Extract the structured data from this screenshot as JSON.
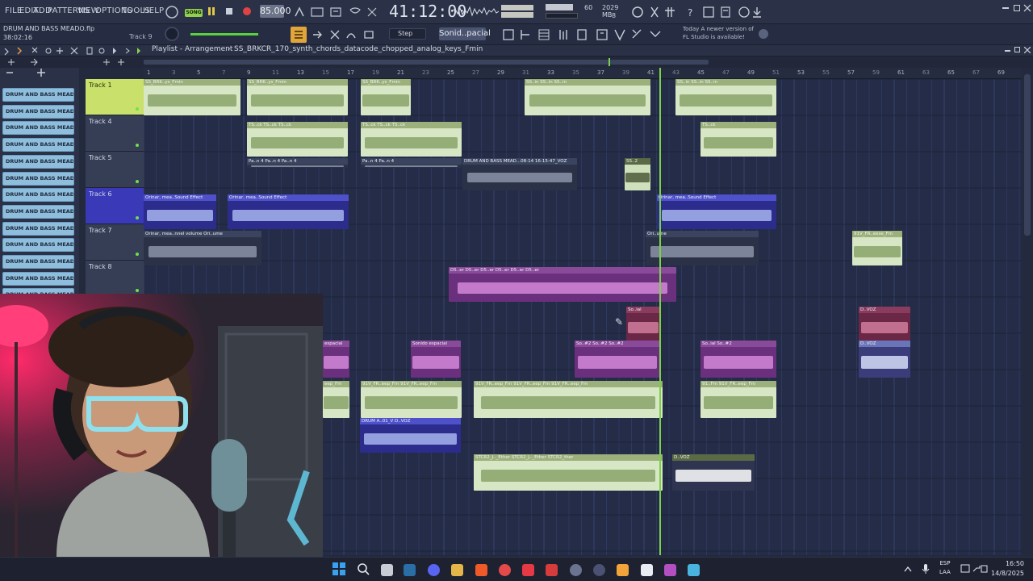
{
  "menu": [
    "FILE",
    "EDIT",
    "ADD",
    "PATTERNS",
    "VIEW",
    "OPTIONS",
    "TOOLS",
    "HELP"
  ],
  "transport": {
    "song_label": "SONG",
    "tempo": "85.000",
    "time": "41:12:00",
    "cpu_ram": "2029 MB",
    "cpu_num": "60",
    "cpu_small": "8"
  },
  "project": {
    "name": "DRUM AND BASS MEADO.flp",
    "time": "38:02:16",
    "focused_track": "Track 9"
  },
  "toolbar": {
    "snap_label": "Step",
    "pattern_selector": "Sonid..pacial"
  },
  "update_notice": {
    "line1": "Today  A newer version of",
    "line2": "FL Studio is available!"
  },
  "playlist": {
    "title": "Playlist - Arrangement",
    "path": "SS_BRKCR_170_synth_chords_datacode_chopped_analog_keys_Fmin"
  },
  "ruler": [
    "1",
    "5",
    "9",
    "13",
    "17",
    "21",
    "25",
    "29",
    "33",
    "37",
    "41",
    "45",
    "49",
    "53",
    "57",
    "61",
    "65",
    "69"
  ],
  "ruler_sub": [
    "3",
    "7",
    "11",
    "15",
    "19",
    "23",
    "27",
    "31",
    "35",
    "39",
    "43",
    "47",
    "51",
    "55",
    "59",
    "63",
    "67"
  ],
  "patterns": [
    "DRUM AND BASS MEADO...",
    "DRUM AND BASS MEADO...",
    "DRUM AND BASS MEADO...",
    "DRUM AND BASS MEADO...",
    "DRUM AND BASS MEADO...",
    "DRUM AND BASS MEADO...",
    "DRUM AND BASS MEADO...",
    "DRUM AND BASS MEADO...",
    "DRUM AND BASS MEADO...",
    "DRUM AND BASS MEADO...",
    "DRUM AND BASS MEADO...",
    "DRUM AND BASS MEADO...",
    "DRUM AND BASS MEADO..."
  ],
  "tracks": [
    "Track 1",
    "Track 4",
    "Track 5",
    "Track 6",
    "Track 7",
    "Track 8"
  ],
  "clips": {
    "c1": "SS_BRK..ys_Fmin",
    "c2": "SS_BRK..ys_Fmin",
    "c3": "SS_BRK..ys_Fmin",
    "c4": "SS..in  SS..in  SS..in",
    "c5": "SS..in  SS..in  SS..in",
    "c6": "TS..ck  TS..ck  TS..ck",
    "c7": "TS..ck  TS..ck  TS..ck",
    "c8": "TS..ck",
    "c9": "Pa..n 4  Pa..n 4  Pa..n 4",
    "c10": "Pa..n 4  Pa..n 4",
    "c11": "DRUM AND BASS MEAD...08-14 16-15-47_VOZ",
    "c12": "SS..2",
    "c13": "Orinar, mea..Sound Effect",
    "c14": "Orinar, mea..Sound Effect",
    "c15": "Orinar, mea..Sound Effect",
    "c16": "Orinar, mea..nnel volume  Ori..ume",
    "c17": "Ori..ume",
    "c18": "91V_FR..eese_Fm",
    "c19": "D5..er  D5..er  D5..er  D5..er  D5..er  D5..er",
    "c20": "So..ial",
    "c21": "D..VOZ",
    "c22": "espacial",
    "c23": "Sonido espacial",
    "c24": "So..#2  So..#2  So..#2",
    "c25": "So..ial  So..#2",
    "c26": "D..VOZ",
    "c27": "eep_Fm",
    "c28": "91V_FR..eep_Fm  91V_FR..eep_Fm",
    "c29": "91V_FR..eep_Fm  91V_FR..eep_Fm  91V_FR..eep_Fm",
    "c30": "91..Fm  91V_FR..eep_Fm",
    "c31": "DRUM A..01_V  D..VOZ",
    "c32": "STCR2_J.._Ether  STCR2_J.._Ether  STCR2_ther",
    "c33": "D..VOZ"
  },
  "taskbar": {
    "lang1": "ESP",
    "lang2": "LAA",
    "time": "16:50",
    "date": "14/8/2025"
  },
  "colors": {
    "bg": "#242c47",
    "grid": "#2a3352",
    "track_header": "#363e56",
    "selected_track": "#c9e06a",
    "green_clip": "#cfe2b8",
    "blue_clip": "#3b3fb5",
    "purple_clip": "#7a3a8f",
    "pink_clip": "#7a2f5a",
    "playhead": "#7ad14a"
  }
}
